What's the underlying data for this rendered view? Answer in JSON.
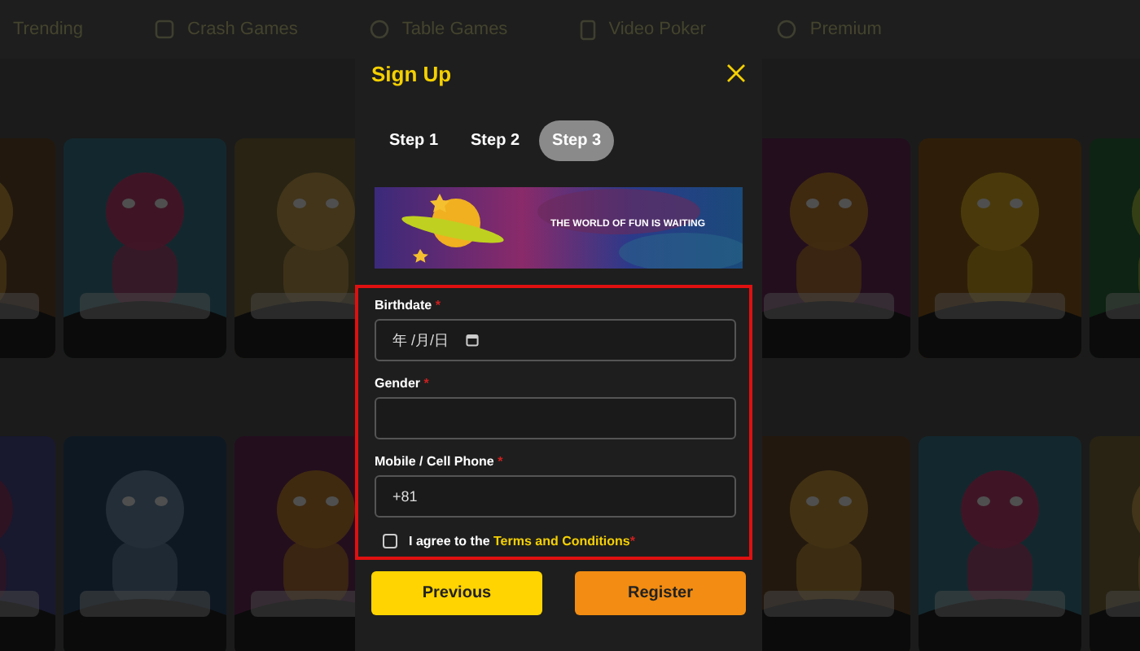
{
  "nav": [
    {
      "label": "Trending",
      "kind": "plain"
    },
    {
      "label": "Crash Games",
      "kind": "square"
    },
    {
      "label": "Table Games",
      "kind": "circle"
    },
    {
      "label": "Video Poker",
      "kind": "card"
    },
    {
      "label": "Premium",
      "kind": "circle"
    }
  ],
  "dialog": {
    "title": "Sign Up",
    "steps": [
      {
        "label": "Step 1",
        "selected": false
      },
      {
        "label": "Step 2",
        "selected": false
      },
      {
        "label": "Step 3",
        "selected": true
      }
    ],
    "banner": {
      "tagline": "THE WORLD OF FUN IS WAITING"
    },
    "highlight_frame": true,
    "fields": [
      {
        "kind": "date",
        "label": "Birthdate",
        "required_mark": "*",
        "placeholder": "年 /月/日"
      },
      {
        "kind": "select",
        "label": "Gender",
        "required_mark": "*"
      },
      {
        "kind": "text",
        "label": "Mobile / Cell Phone",
        "required_mark": "*",
        "value": "+81"
      }
    ],
    "agree": {
      "checked": false,
      "text": "I agree to the ",
      "link": "Terms and Conditions",
      "required_mark": "*"
    },
    "buttons": [
      {
        "label": "Previous",
        "kind": "secondary"
      },
      {
        "label": "Register",
        "kind": "primary"
      }
    ]
  }
}
